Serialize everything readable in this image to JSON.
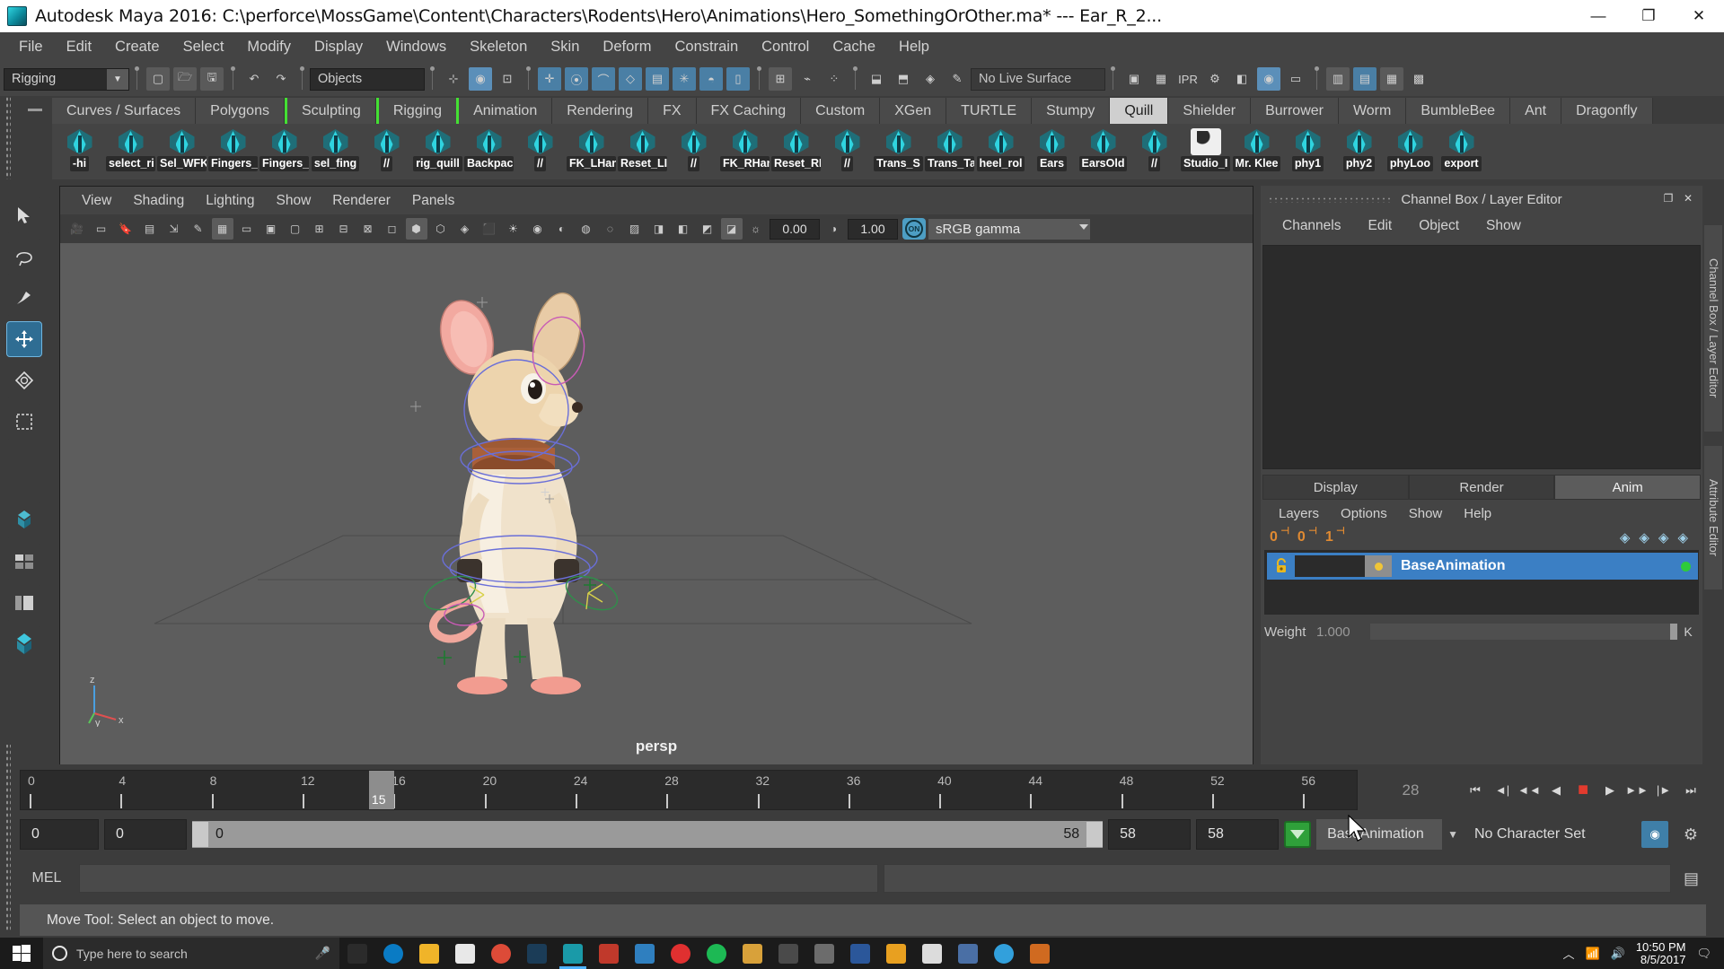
{
  "titlebar": {
    "title": "Autodesk Maya 2016: C:\\perforce\\MossGame\\Content\\Characters\\Rodents\\Hero\\Animations\\Hero_SomethingOrOther.ma*   ---   Ear_R_2...",
    "minimize": "—",
    "maximize": "❐",
    "close": "✕"
  },
  "menubar": {
    "items": [
      "File",
      "Edit",
      "Create",
      "Select",
      "Modify",
      "Display",
      "Windows",
      "Skeleton",
      "Skin",
      "Deform",
      "Constrain",
      "Control",
      "Cache",
      "Help"
    ]
  },
  "statusline": {
    "mode": "Rigging",
    "object_field": "Objects",
    "no_live_surface": "No Live Surface"
  },
  "shelf": {
    "tabs": [
      {
        "label": "Curves / Surfaces",
        "active": false
      },
      {
        "label": "Polygons",
        "active": false
      },
      {
        "label": "Sculpting",
        "active": false,
        "bracket_left": true
      },
      {
        "label": "Rigging",
        "active": false,
        "bracket_left": true,
        "bracket_right": true
      },
      {
        "label": "Animation",
        "active": false
      },
      {
        "label": "Rendering",
        "active": false
      },
      {
        "label": "FX",
        "active": false
      },
      {
        "label": "FX Caching",
        "active": false
      },
      {
        "label": "Custom",
        "active": false
      },
      {
        "label": "XGen",
        "active": false
      },
      {
        "label": "TURTLE",
        "active": false
      },
      {
        "label": "Stumpy",
        "active": false
      },
      {
        "label": "Quill",
        "active": true
      },
      {
        "label": "Shielder",
        "active": false
      },
      {
        "label": "Burrower",
        "active": false
      },
      {
        "label": "Worm",
        "active": false
      },
      {
        "label": "BumbleBee",
        "active": false
      },
      {
        "label": "Ant",
        "active": false
      },
      {
        "label": "Dragonfly",
        "active": false
      }
    ],
    "buttons": [
      {
        "label": "-hi",
        "icon": "mel-script-icon"
      },
      {
        "label": "select_ri",
        "icon": "mel-script-icon"
      },
      {
        "label": "Sel_WFK",
        "icon": "mel-script-icon"
      },
      {
        "label": "Fingers_",
        "icon": "mel-script-icon"
      },
      {
        "label": "Fingers_",
        "icon": "mel-script-icon"
      },
      {
        "label": "sel_fing",
        "icon": "mel-script-icon"
      },
      {
        "label": "//",
        "icon": "mel-script-icon"
      },
      {
        "label": "rig_quill",
        "icon": "mel-script-icon"
      },
      {
        "label": "Backpac",
        "icon": "mel-script-icon"
      },
      {
        "label": "//",
        "icon": "mel-script-icon"
      },
      {
        "label": "FK_LHan",
        "icon": "mel-script-icon"
      },
      {
        "label": "Reset_LI",
        "icon": "mel-script-icon"
      },
      {
        "label": "//",
        "icon": "mel-script-icon"
      },
      {
        "label": "FK_RHan",
        "icon": "mel-script-icon"
      },
      {
        "label": "Reset_RI",
        "icon": "mel-script-icon"
      },
      {
        "label": "//",
        "icon": "mel-script-icon"
      },
      {
        "label": "Trans_S",
        "icon": "mel-script-icon"
      },
      {
        "label": "Trans_Ta",
        "icon": "mel-script-icon"
      },
      {
        "label": "heel_rol",
        "icon": "mel-script-icon"
      },
      {
        "label": "Ears",
        "icon": "mel-script-icon"
      },
      {
        "label": "EarsOld",
        "icon": "mel-script-icon"
      },
      {
        "label": "//",
        "icon": "mel-script-icon"
      },
      {
        "label": "Studio_I",
        "icon": "python-script-icon"
      },
      {
        "label": "Mr. Klee",
        "icon": "mel-script-icon"
      },
      {
        "label": "phy1",
        "icon": "mel-script-icon"
      },
      {
        "label": "phy2",
        "icon": "mel-script-icon"
      },
      {
        "label": "phyLoo",
        "icon": "mel-script-icon"
      },
      {
        "label": "export",
        "icon": "mel-script-icon"
      }
    ]
  },
  "viewport": {
    "menu": [
      "View",
      "Shading",
      "Lighting",
      "Show",
      "Renderer",
      "Panels"
    ],
    "exposure": "0.00",
    "gamma": "1.00",
    "color_mgmt_toggle": "ON",
    "color_profile": "sRGB gamma",
    "camera_label": "persp",
    "axis": {
      "x": "x",
      "y": "y",
      "z": "z"
    }
  },
  "right_panel": {
    "title": "Channel Box / Layer Editor",
    "undock": "❐",
    "close": "✕",
    "tabs": [
      "Channels",
      "Edit",
      "Object",
      "Show"
    ],
    "layer_tabs": [
      {
        "label": "Display",
        "active": false
      },
      {
        "label": "Render",
        "active": false
      },
      {
        "label": "Anim",
        "active": true
      }
    ],
    "layer_menu": [
      "Layers",
      "Options",
      "Show",
      "Help"
    ],
    "key_icons": [
      "0",
      "0",
      "1"
    ],
    "layers": [
      {
        "name": "BaseAnimation",
        "selected": true,
        "locked": false,
        "keyed": true
      }
    ],
    "weight_label": "Weight",
    "weight_value": "1.000",
    "weight_key": "K",
    "vertical_tabs": [
      "Channel Box / Layer Editor",
      "Attribute Editor"
    ]
  },
  "timeline": {
    "ticks": [
      "0",
      "4",
      "8",
      "12",
      "16",
      "20",
      "24",
      "28",
      "32",
      "36",
      "40",
      "44",
      "48",
      "52",
      "56"
    ],
    "current_frame": "15",
    "frame_field": "28",
    "playback_buttons": [
      "go-to-start",
      "step-back-key",
      "step-back-frame",
      "play-backwards",
      "stop",
      "play-forwards",
      "step-forward-frame",
      "step-forward-key",
      "go-to-end"
    ]
  },
  "range": {
    "anim_start": "0",
    "range_start": "0",
    "slider_start": "0",
    "slider_end": "58",
    "range_end": "58",
    "anim_end": "58",
    "anim_layer": "BaseAnimation",
    "character_set": "No Character Set"
  },
  "command": {
    "label": "MEL",
    "input": "",
    "output": ""
  },
  "help": {
    "message": "Move Tool: Select an object to move."
  },
  "taskbar": {
    "search_placeholder": "Type here to search",
    "clock_time": "10:50 PM",
    "clock_date": "8/5/2017",
    "apps": [
      {
        "name": "task-view-icon",
        "color": "#2b2b2b"
      },
      {
        "name": "edge-icon",
        "color": "#0a7bc4"
      },
      {
        "name": "file-explorer-icon",
        "color": "#f0b429"
      },
      {
        "name": "microsoft-store-icon",
        "color": "#e8e8e8"
      },
      {
        "name": "chrome-icon",
        "color": "#dd4b38"
      },
      {
        "name": "steam-icon",
        "color": "#1b3c57"
      },
      {
        "name": "maya-icon",
        "color": "#1a9aa8"
      },
      {
        "name": "substance-icon",
        "color": "#c0392b"
      },
      {
        "name": "shield-icon",
        "color": "#2f7fbf"
      },
      {
        "name": "q-app-icon",
        "color": "#e03030"
      },
      {
        "name": "spotify-icon",
        "color": "#1db954"
      },
      {
        "name": "folder-icon",
        "color": "#d8a13a"
      },
      {
        "name": "globe-icon",
        "color": "#4a4a4a"
      },
      {
        "name": "calculator-icon",
        "color": "#6c6c6c"
      },
      {
        "name": "word-icon",
        "color": "#2b579a"
      },
      {
        "name": "fz-icon",
        "color": "#e8a020"
      },
      {
        "name": "k-app-icon",
        "color": "#dcdcdc"
      },
      {
        "name": "app2-icon",
        "color": "#4a6fa5"
      },
      {
        "name": "chrome2-icon",
        "color": "#32a0dc"
      },
      {
        "name": "chart-icon",
        "color": "#d06a20"
      }
    ]
  },
  "colors": {
    "accent_blue": "#3b7fc4",
    "shelf_active": "#cfcfcf",
    "green_bracket": "#44e033",
    "record_red": "#e23b2e",
    "orange_key": "#e08a32"
  }
}
